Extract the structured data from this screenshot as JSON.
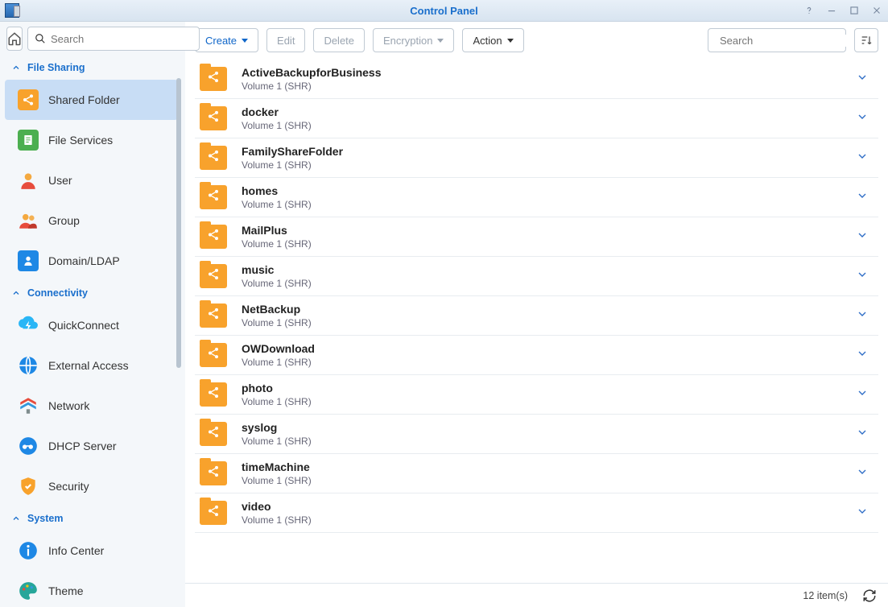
{
  "window": {
    "title": "Control Panel"
  },
  "sidebar": {
    "search_placeholder": "Search",
    "groups": [
      {
        "label": "File Sharing",
        "items": [
          {
            "label": "Shared Folder",
            "icon": "shared-folder",
            "active": true
          },
          {
            "label": "File Services",
            "icon": "file-services"
          },
          {
            "label": "User",
            "icon": "user"
          },
          {
            "label": "Group",
            "icon": "group"
          },
          {
            "label": "Domain/LDAP",
            "icon": "domain-ldap"
          }
        ]
      },
      {
        "label": "Connectivity",
        "items": [
          {
            "label": "QuickConnect",
            "icon": "quickconnect"
          },
          {
            "label": "External Access",
            "icon": "external-access"
          },
          {
            "label": "Network",
            "icon": "network"
          },
          {
            "label": "DHCP Server",
            "icon": "dhcp-server"
          },
          {
            "label": "Security",
            "icon": "security"
          }
        ]
      },
      {
        "label": "System",
        "items": [
          {
            "label": "Info Center",
            "icon": "info-center"
          },
          {
            "label": "Theme",
            "icon": "theme"
          }
        ]
      }
    ]
  },
  "toolbar": {
    "create": "Create",
    "edit": "Edit",
    "delete": "Delete",
    "encryption": "Encryption",
    "action": "Action",
    "search_placeholder": "Search"
  },
  "folders": [
    {
      "name": "ActiveBackupforBusiness",
      "volume": "Volume 1 (SHR)"
    },
    {
      "name": "docker",
      "volume": "Volume 1 (SHR)"
    },
    {
      "name": "FamilyShareFolder",
      "volume": "Volume 1 (SHR)"
    },
    {
      "name": "homes",
      "volume": "Volume 1 (SHR)"
    },
    {
      "name": "MailPlus",
      "volume": "Volume 1 (SHR)"
    },
    {
      "name": "music",
      "volume": "Volume 1 (SHR)"
    },
    {
      "name": "NetBackup",
      "volume": "Volume 1 (SHR)"
    },
    {
      "name": "OWDownload",
      "volume": "Volume 1 (SHR)"
    },
    {
      "name": "photo",
      "volume": "Volume 1 (SHR)"
    },
    {
      "name": "syslog",
      "volume": "Volume 1 (SHR)"
    },
    {
      "name": "timeMachine",
      "volume": "Volume 1 (SHR)"
    },
    {
      "name": "video",
      "volume": "Volume 1 (SHR)"
    }
  ],
  "footer": {
    "count_text": "12 item(s)"
  }
}
